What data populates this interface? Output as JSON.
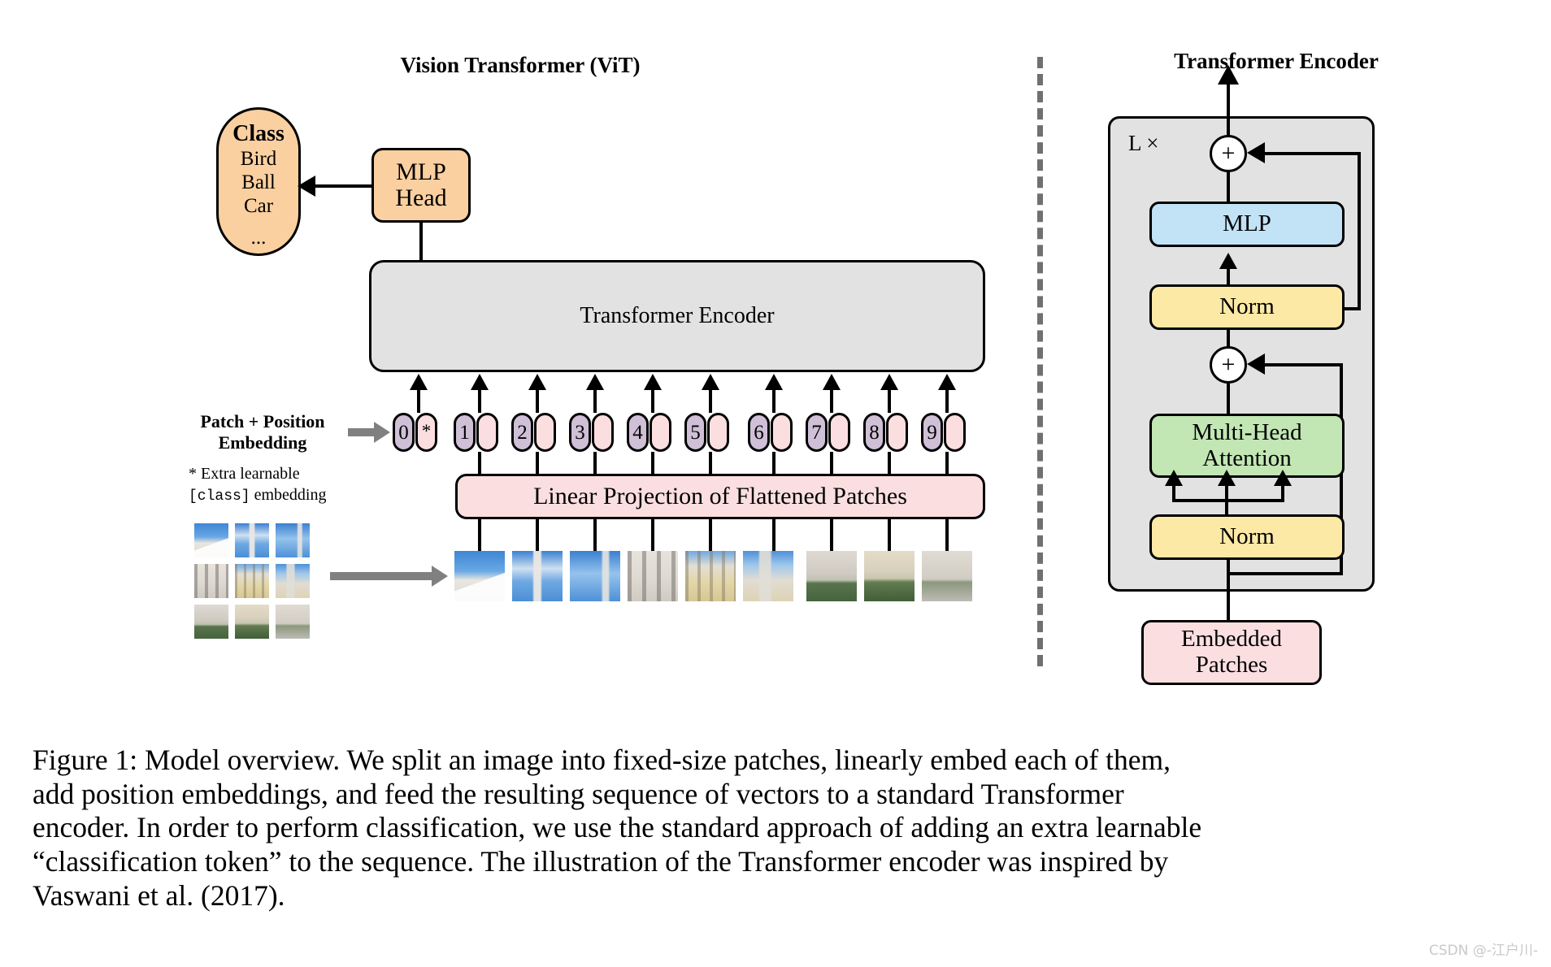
{
  "figure": {
    "left_panel_title": "Vision Transformer (ViT)",
    "right_panel_title": "Transformer Encoder"
  },
  "class_head": {
    "title": "Class",
    "items": [
      "Bird",
      "Ball",
      "Car"
    ],
    "ellipsis": "...",
    "mlp_head_label": "MLP\nHead",
    "mlp_head_line1": "MLP",
    "mlp_head_line2": "Head"
  },
  "vit": {
    "encoder_label": "Transformer Encoder",
    "linear_projection_label": "Linear Projection of Flattened Patches",
    "patch_position_label_line1": "Patch + Position",
    "patch_position_label_line2": "Embedding",
    "extra_learnable_line1": "* Extra learnable",
    "extra_learnable_token": "[class]",
    "extra_learnable_line2_rest": " embedding",
    "tokens": [
      {
        "pos": "0",
        "emb": "*"
      },
      {
        "pos": "1",
        "emb": ""
      },
      {
        "pos": "2",
        "emb": ""
      },
      {
        "pos": "3",
        "emb": ""
      },
      {
        "pos": "4",
        "emb": ""
      },
      {
        "pos": "5",
        "emb": ""
      },
      {
        "pos": "6",
        "emb": ""
      },
      {
        "pos": "7",
        "emb": ""
      },
      {
        "pos": "8",
        "emb": ""
      },
      {
        "pos": "9",
        "emb": ""
      }
    ]
  },
  "encoder": {
    "repeat_label": "L ×",
    "plus_symbol": "+",
    "mlp_label": "MLP",
    "norm_top_label": "Norm",
    "attention_line1": "Multi-Head",
    "attention_line2": "Attention",
    "norm_bottom_label": "Norm",
    "embedded_patches_line1": "Embedded",
    "embedded_patches_line2": "Patches"
  },
  "caption": {
    "line1": "Figure 1: Model overview. We split an image into fixed-size patches, linearly embed each of them,",
    "line2": "add position embeddings, and feed the resulting sequence of vectors to a standard Transformer",
    "line3": "encoder. In order to perform classification, we use the standard approach of adding an extra learnable",
    "line4": "“classification token” to the sequence. The illustration of the Transformer encoder was inspired by",
    "line5": "Vaswani et al. (2017)."
  },
  "watermark": {
    "text": "CSDN @-江户川-"
  },
  "colors": {
    "orange": "#fbd0a0",
    "grey": "#e2e2e2",
    "pink": "#fbdfe0",
    "blue": "#c2e2f5",
    "yellow": "#fce9a6",
    "green": "#c2e6b4",
    "purple": "#cfc0d7",
    "divider": "#707070",
    "grey_arrow": "#808080"
  }
}
